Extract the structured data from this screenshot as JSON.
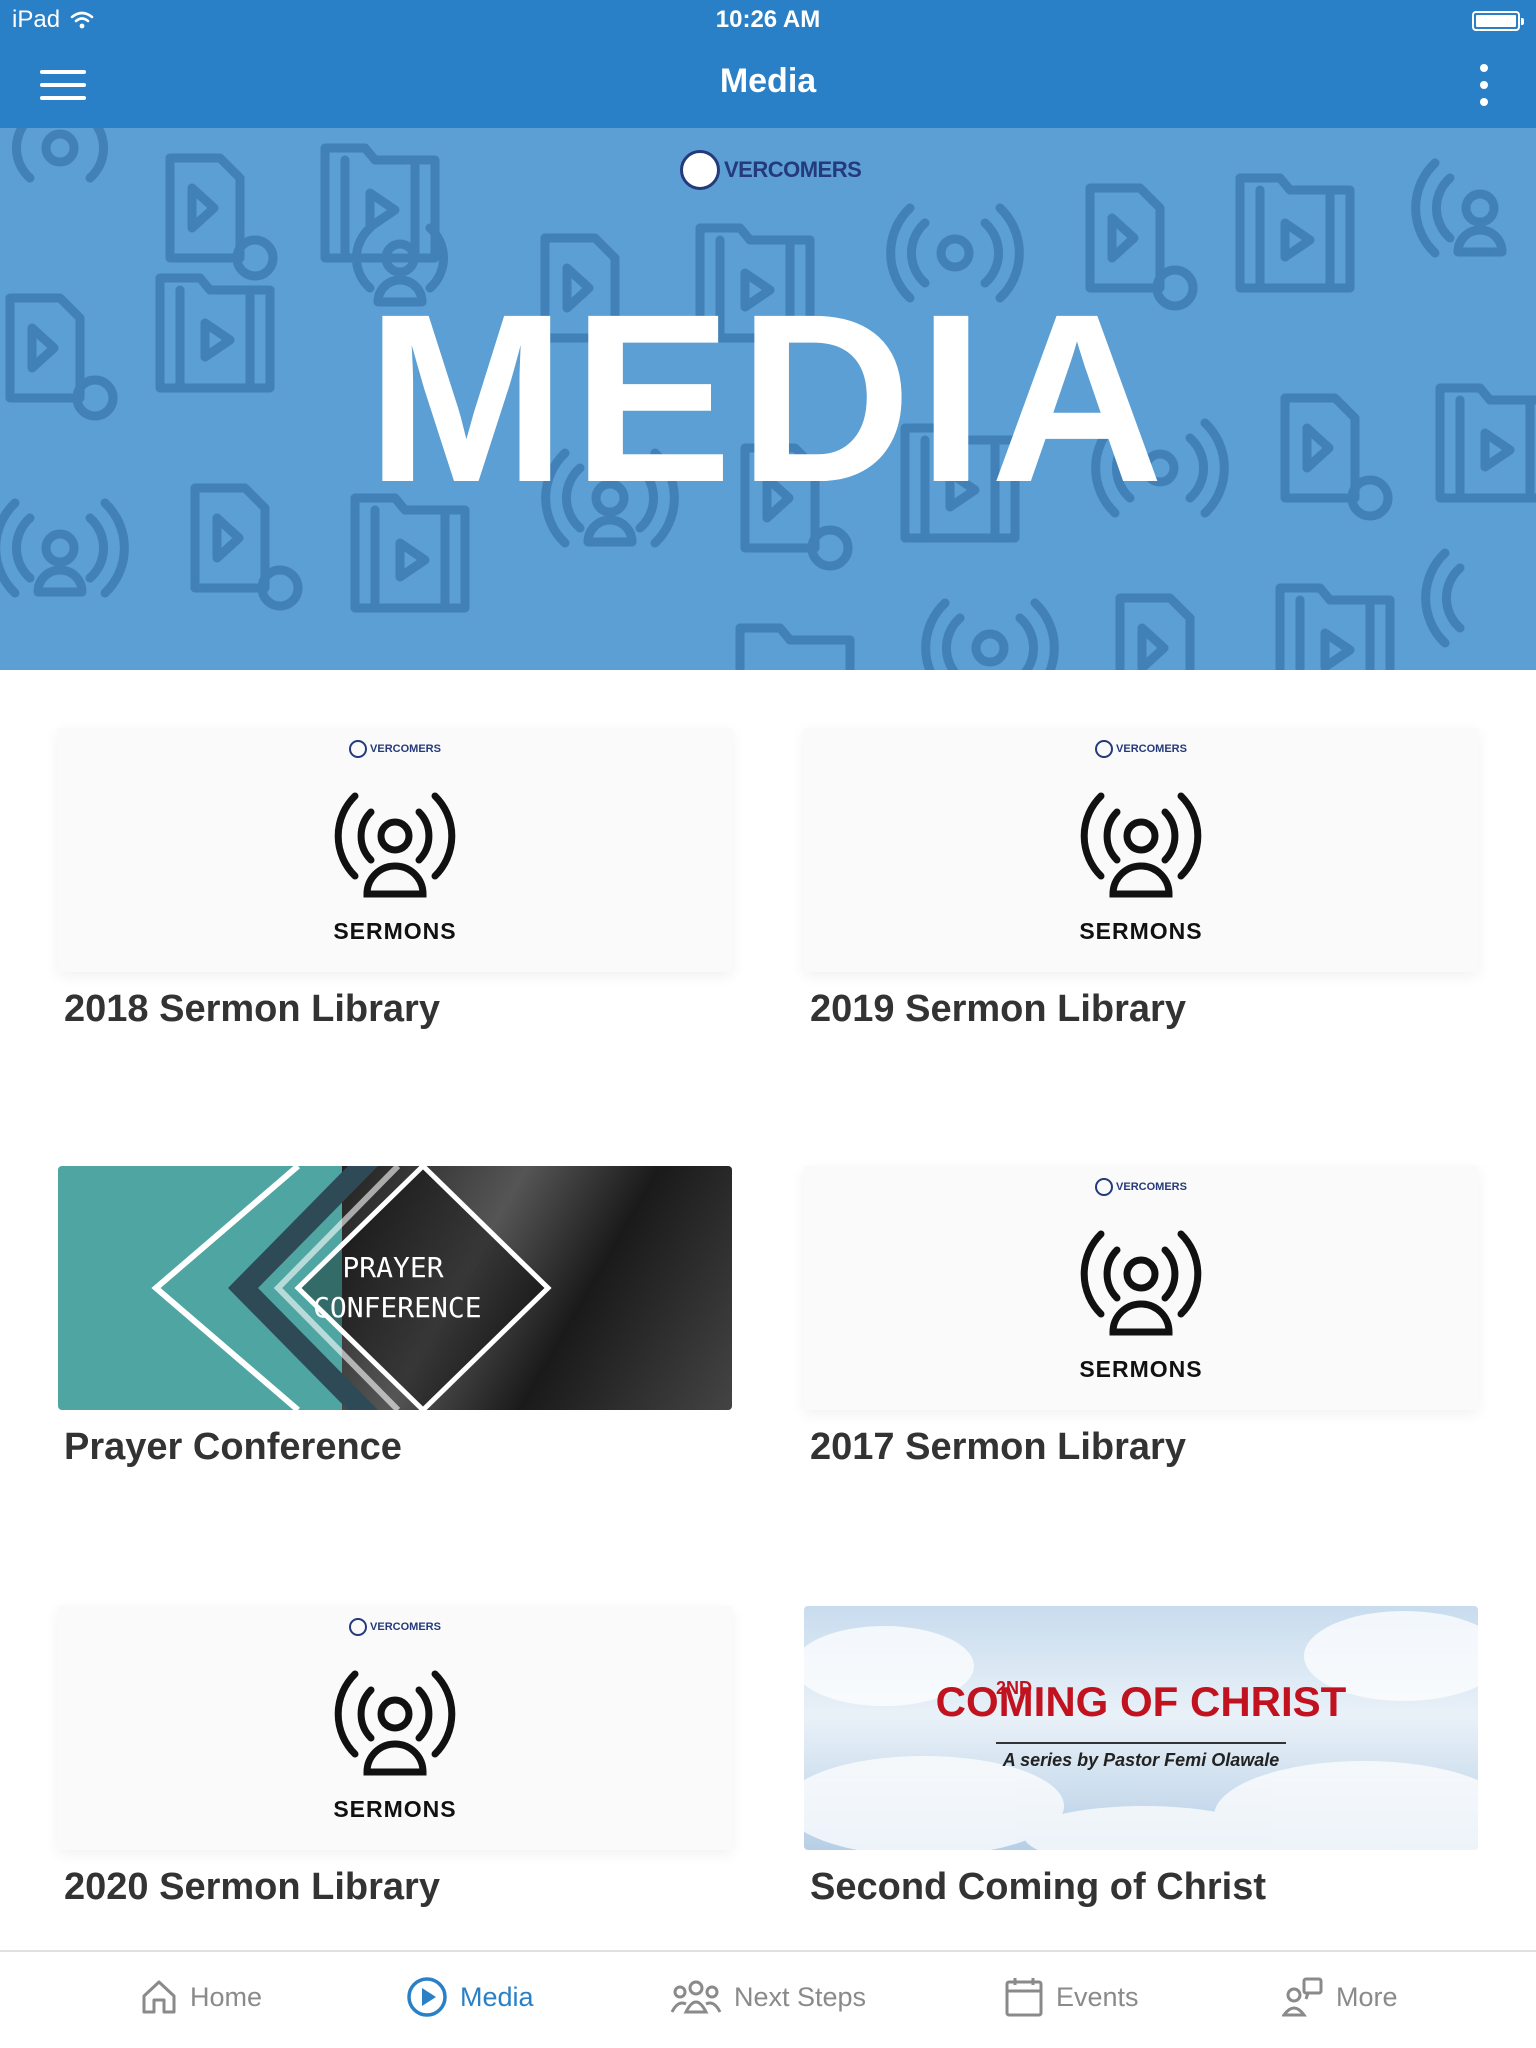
{
  "status_bar": {
    "device": "iPad",
    "time": "10:26 AM"
  },
  "nav": {
    "title": "Media"
  },
  "hero": {
    "logo_text": "VERCOMERS",
    "title": "MEDIA"
  },
  "cards": [
    {
      "caption": "2018 Sermon Library",
      "thumb": "sermon",
      "thumb_label": "SERMONS",
      "logo_text": "VERCOMERS"
    },
    {
      "caption": "2019 Sermon Library",
      "thumb": "sermon",
      "thumb_label": "SERMONS",
      "logo_text": "VERCOMERS"
    },
    {
      "caption": "Prayer Conference",
      "thumb": "prayer",
      "thumb_line1": "PRAYER",
      "thumb_line2": "CONFERENCE"
    },
    {
      "caption": "2017 Sermon Library",
      "thumb": "sermon",
      "thumb_label": "SERMONS",
      "logo_text": "VERCOMERS"
    },
    {
      "caption": "2020 Sermon Library",
      "thumb": "sermon",
      "thumb_label": "SERMONS",
      "logo_text": "VERCOMERS"
    },
    {
      "caption": "Second Coming of Christ",
      "thumb": "coming",
      "thumb_num": "2ND",
      "thumb_title": "COMING OF CHRIST",
      "thumb_sub": "A series by Pastor Femi Olawale"
    }
  ],
  "tabs": [
    {
      "label": "Home",
      "icon": "home-icon"
    },
    {
      "label": "Media",
      "icon": "play-circle-icon",
      "active": true
    },
    {
      "label": "Next Steps",
      "icon": "people-icon"
    },
    {
      "label": "Events",
      "icon": "calendar-icon"
    },
    {
      "label": "More",
      "icon": "more-icon"
    }
  ],
  "colors": {
    "brand_blue": "#2a80c6",
    "hero_blue": "#5b9fd4",
    "tab_inactive": "#8a8a8a"
  }
}
